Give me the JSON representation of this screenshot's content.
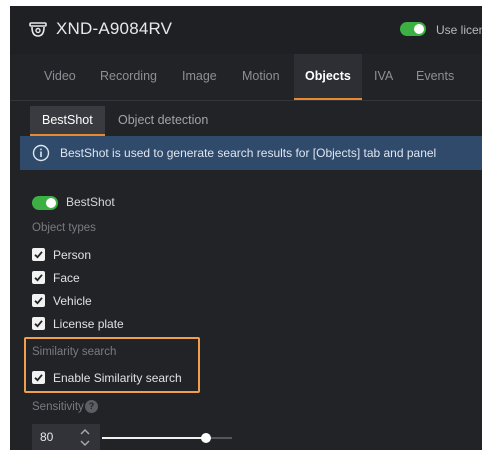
{
  "header": {
    "device_name": "XND-A9084RV",
    "license_toggle_label": "Use licens",
    "license_toggle_on": true
  },
  "tabs": [
    {
      "label": "Video"
    },
    {
      "label": "Recording"
    },
    {
      "label": "Image"
    },
    {
      "label": "Motion"
    },
    {
      "label": "Objects",
      "active": true
    },
    {
      "label": "IVA"
    },
    {
      "label": "Events"
    }
  ],
  "subtabs": [
    {
      "label": "BestShot",
      "active": true
    },
    {
      "label": "Object detection"
    }
  ],
  "info_banner": {
    "text": "BestShot is used to generate search results for [Objects] tab and panel"
  },
  "bestshot": {
    "label": "BestShot",
    "enabled": true
  },
  "object_types": {
    "label": "Object types",
    "items": [
      {
        "label": "Person",
        "checked": true
      },
      {
        "label": "Face",
        "checked": true
      },
      {
        "label": "Vehicle",
        "checked": true
      },
      {
        "label": "License plate",
        "checked": true
      }
    ]
  },
  "similarity_search": {
    "label": "Similarity search",
    "option_label": "Enable Similarity search",
    "checked": true
  },
  "sensitivity": {
    "label": "Sensitivity",
    "value": "80",
    "level": 0.8
  },
  "colors": {
    "accent": "#e88a2e",
    "highlight": "#f0a04a",
    "toggle_on": "#3cb043",
    "info_bg": "#2f4a6b"
  }
}
